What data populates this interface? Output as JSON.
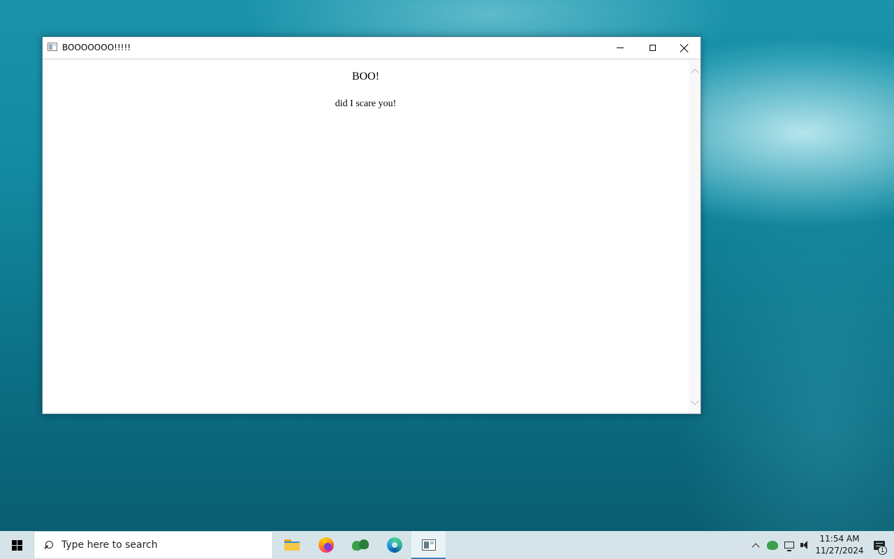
{
  "window": {
    "title": "BOOOOOOO!!!!!",
    "heading": "BOO!",
    "body_text": "did I scare you!",
    "icon": "app-window-icon",
    "controls": [
      "minimize-icon",
      "maximize-icon",
      "close-icon"
    ]
  },
  "taskbar": {
    "search_placeholder": "Type here to search",
    "pinned_apps": [
      {
        "icon": "file-explorer-icon"
      },
      {
        "icon": "firefox-icon"
      },
      {
        "icon": "green-people-app-icon"
      },
      {
        "icon": "edge-icon"
      },
      {
        "icon": "window-app-icon",
        "active": true
      }
    ],
    "tray": {
      "time": "11:54 AM",
      "date": "11/27/2024",
      "notification_count": "1"
    }
  },
  "colors": {
    "taskbar_bg": "#d6e4ea",
    "active_indicator": "#3f80b0",
    "desktop_bg": "#138aa1"
  }
}
